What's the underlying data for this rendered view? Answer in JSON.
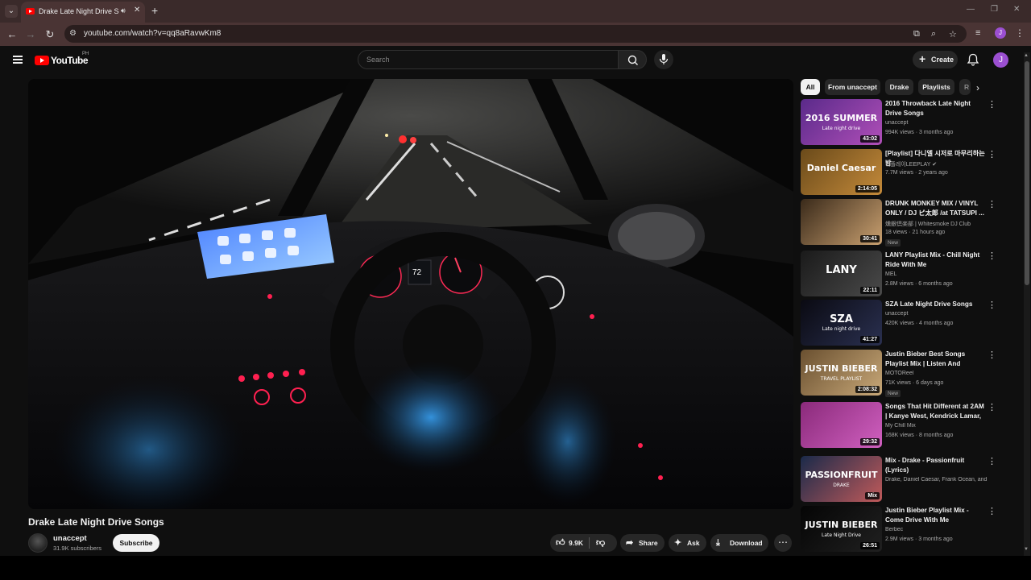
{
  "browser": {
    "tab_title": "Drake Late Night Drive Songs",
    "url": "youtube.com/watch?v=qq8aRavwKm8",
    "profile_initial": "J"
  },
  "header": {
    "logo_text": "YouTube",
    "country_code": "PH",
    "search_placeholder": "Search",
    "create_label": "Create",
    "avatar_initial": "J"
  },
  "video": {
    "title": "Drake Late Night Drive Songs",
    "channel": "unaccept",
    "subscribers": "31.9K subscribers",
    "subscribe_label": "Subscribe",
    "likes": "9.9K",
    "share_label": "Share",
    "ask_label": "Ask",
    "download_label": "Download",
    "speedometer": "72"
  },
  "chips": [
    "All",
    "From unaccept",
    "Drake",
    "Playlists",
    "R"
  ],
  "recommendations": [
    {
      "title": "2016 Throwback Late Night Drive Songs",
      "channel": "unaccept",
      "meta": "994K views · 3 months ago",
      "duration": "43:02",
      "thumb_text": "2016 SUMMER",
      "thumb_sub": "Late night drive",
      "badge": "",
      "verified": false,
      "colors": [
        "#5a2a8a",
        "#b04fb8"
      ]
    },
    {
      "title": "[Playlist] 다니엘 시저로 마무리하는 밤",
      "channel": "리플레이LEEPLAY",
      "meta": "7.7M views · 2 years ago",
      "duration": "2:14:05",
      "thumb_text": "Daniel Caesar",
      "thumb_sub": "",
      "badge": "",
      "verified": true,
      "colors": [
        "#6a4a1a",
        "#c48a3a"
      ]
    },
    {
      "title": "DRUNK MONKEY MIX / VINYL ONLY / DJ ピ太郎 /at TATSUPI ...",
      "channel": "燻銀倶楽部 | Whitesmoke DJ Club",
      "meta": "18 views · 21 hours ago",
      "duration": "30:41",
      "thumb_text": "",
      "thumb_sub": "",
      "badge": "New",
      "verified": false,
      "colors": [
        "#3a2a1a",
        "#c9a070"
      ]
    },
    {
      "title": "LANY Playlist Mix - Chill Night Ride With Me",
      "channel": "MEL",
      "meta": "2.8M views · 6 months ago",
      "duration": "22:11",
      "thumb_text": "LANY",
      "thumb_sub": "",
      "badge": "",
      "verified": false,
      "colors": [
        "#1a1a1a",
        "#4a4a4a"
      ]
    },
    {
      "title": "SZA Late Night Drive Songs",
      "channel": "unaccept",
      "meta": "420K views · 4 months ago",
      "duration": "41:27",
      "thumb_text": "SZA",
      "thumb_sub": "Late night drive",
      "badge": "",
      "verified": false,
      "colors": [
        "#0a0a12",
        "#2a3050"
      ]
    },
    {
      "title": "Justin Bieber Best Songs Playlist Mix | Listen And Travel...",
      "channel": "MOTOReel",
      "meta": "71K views · 6 days ago",
      "duration": "2:08:32",
      "thumb_text": "JUSTIN BIEBER",
      "thumb_sub": "TRAVEL PLAYLIST",
      "badge": "New",
      "verified": false,
      "colors": [
        "#6a5030",
        "#c8a878"
      ]
    },
    {
      "title": "Songs That Hit Different at 2AM | Kanye West, Kendrick Lamar, ...",
      "channel": "My Chill Mix",
      "meta": "168K views · 8 months ago",
      "duration": "29:32",
      "thumb_text": "",
      "thumb_sub": "",
      "badge": "",
      "verified": false,
      "colors": [
        "#8a2a7a",
        "#d060c0"
      ]
    },
    {
      "title": "Mix - Drake - Passionfruit (Lyrics)",
      "channel": "Drake, Daniel Caesar, Frank Ocean, and ...",
      "meta": "",
      "duration": "Mix",
      "thumb_text": "PASSIONFRUIT",
      "thumb_sub": "DRAKE",
      "badge": "",
      "verified": false,
      "colors": [
        "#1a2a4a",
        "#c05a5a"
      ]
    },
    {
      "title": "Justin Bieber Playlist Mix - Come Drive With Me",
      "channel": "Berbec",
      "meta": "2.9M views · 3 months ago",
      "duration": "26:51",
      "thumb_text": "JUSTIN BIEBER",
      "thumb_sub": "Late Night Drive",
      "badge": "",
      "verified": false,
      "colors": [
        "#050505",
        "#202020"
      ]
    }
  ]
}
